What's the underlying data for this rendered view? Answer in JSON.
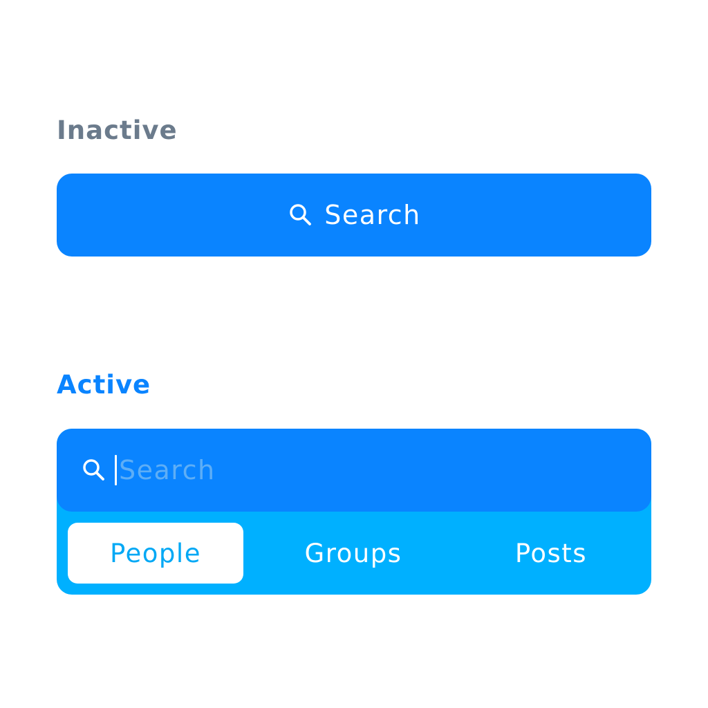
{
  "sections": {
    "inactive_label": "Inactive",
    "active_label": "Active"
  },
  "inactive_search": {
    "label": "Search",
    "icon": "search-icon"
  },
  "active_search": {
    "placeholder": "Search",
    "value": "",
    "icon": "search-icon",
    "tabs": [
      {
        "label": "People",
        "selected": true
      },
      {
        "label": "Groups",
        "selected": false
      },
      {
        "label": "Posts",
        "selected": false
      }
    ]
  },
  "colors": {
    "accent": "#0a84ff",
    "tab_bar": "#00b0ff",
    "inactive_label": "#6b7b8c",
    "placeholder": "#5eaef6"
  }
}
